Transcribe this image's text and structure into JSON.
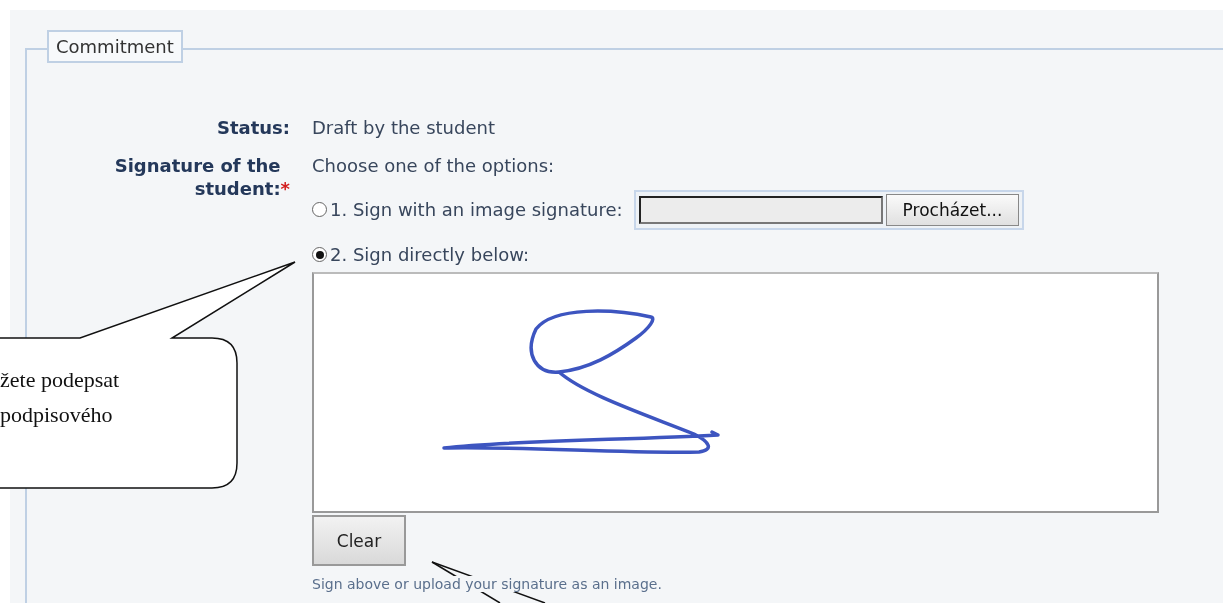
{
  "fieldset": {
    "legend": "Commitment"
  },
  "fields": [
    {
      "kind": "text",
      "label": "Status:",
      "value": "Draft by the student"
    },
    {
      "kind": "signature",
      "label": "Signature of the student:",
      "required_mark": "*",
      "prompt": "Choose one of the options:",
      "options": [
        {
          "kind": "file",
          "label": "1. Sign with an image signature:",
          "selected": false,
          "button": "Procházet..."
        },
        {
          "kind": "pad",
          "label": "2. Sign directly below:",
          "selected": true
        }
      ],
      "clear_button": "Clear",
      "hint": "Sign above or upload your signature as an image."
    }
  ],
  "callout": {
    "text": "žete podepsat\npodpisového"
  }
}
